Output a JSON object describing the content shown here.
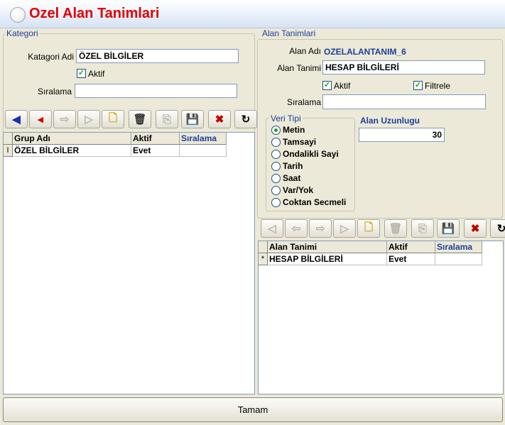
{
  "window": {
    "title": "Ozel Alan Tanimlari"
  },
  "kategori": {
    "legend": "Kategori",
    "adi_label": "Katagori Adi",
    "adi_value": "ÖZEL BİLGİLER",
    "aktif_label": "Aktif",
    "aktif_checked": true,
    "siralama_label": "Sıralama",
    "siralama_value": "",
    "toolbar": [
      {
        "name": "first-icon",
        "glyph": "◀",
        "enabled": true,
        "color": "#1a2fb0"
      },
      {
        "name": "prev-icon",
        "glyph": "◂",
        "enabled": true,
        "color": "#d00000"
      },
      {
        "name": "next-icon",
        "glyph": "⇨",
        "enabled": false
      },
      {
        "name": "last-icon",
        "glyph": "▷",
        "enabled": false
      },
      {
        "name": "new-icon",
        "glyph": "🗋",
        "enabled": true,
        "color": "#c8a400"
      },
      {
        "name": "delete-icon",
        "glyph": "🗑",
        "enabled": true,
        "color": "#333333"
      },
      {
        "name": "copy-icon",
        "glyph": "⎘",
        "enabled": false
      },
      {
        "name": "save-icon",
        "glyph": "💾",
        "enabled": true,
        "color": "#000000"
      },
      {
        "name": "cancel-icon",
        "glyph": "✖",
        "enabled": true,
        "color": "#c00000"
      },
      {
        "name": "refresh-icon",
        "glyph": "↻",
        "enabled": true,
        "color": "#000000"
      }
    ],
    "grid": {
      "columns": [
        "Grup Adı",
        "Aktif",
        "Sıralama"
      ],
      "rows": [
        {
          "marker": "I",
          "cells": [
            "ÖZEL BİLGİLER",
            "Evet",
            ""
          ]
        }
      ]
    }
  },
  "alan": {
    "legend": "Alan Tanimlari",
    "adi_label": "Alan Adı",
    "adi_value": "OZELALANTANIM_6",
    "tanimi_label": "Alan Tanimi",
    "tanimi_value": "HESAP BİLGİLERİ",
    "aktif_label": "Aktif",
    "aktif_checked": true,
    "filtrele_label": "Filtrele",
    "filtrele_checked": true,
    "siralama_label": "Sıralama",
    "siralama_value": "",
    "veri_tipi": {
      "legend": "Veri Tipi",
      "options": [
        "Metin",
        "Tamsayi",
        "Ondalikli Sayi",
        "Tarih",
        "Saat",
        "Var/Yok",
        "Coktan Secmeli"
      ],
      "selected": "Metin"
    },
    "uzunluk_label": "Alan Uzunlugu",
    "uzunluk_value": "30",
    "toolbar": [
      {
        "name": "first-icon",
        "glyph": "◁",
        "enabled": false
      },
      {
        "name": "prev-icon",
        "glyph": "⇦",
        "enabled": false
      },
      {
        "name": "next-icon",
        "glyph": "⇨",
        "enabled": false
      },
      {
        "name": "last-icon",
        "glyph": "▷",
        "enabled": false
      },
      {
        "name": "new-icon",
        "glyph": "🗋",
        "enabled": true,
        "color": "#c8a400"
      },
      {
        "name": "delete-icon",
        "glyph": "🗑",
        "enabled": false
      },
      {
        "name": "copy-icon",
        "glyph": "⎘",
        "enabled": false
      },
      {
        "name": "save-icon",
        "glyph": "💾",
        "enabled": true,
        "color": "#000000"
      },
      {
        "name": "cancel-icon",
        "glyph": "✖",
        "enabled": true,
        "color": "#c00000"
      },
      {
        "name": "refresh-icon",
        "glyph": "↻",
        "enabled": true,
        "color": "#000000"
      }
    ],
    "grid": {
      "columns": [
        "Alan Tanimi",
        "Aktif",
        "Sıralama"
      ],
      "rows": [
        {
          "marker": "*",
          "cells": [
            "HESAP BİLGİLERİ",
            "Evet",
            ""
          ]
        }
      ]
    }
  },
  "footer": {
    "ok_label": "Tamam"
  },
  "colors": {
    "title": "#e00000",
    "legend": "#1c3f9c",
    "face": "#ece9d8",
    "check": "#21a121"
  }
}
